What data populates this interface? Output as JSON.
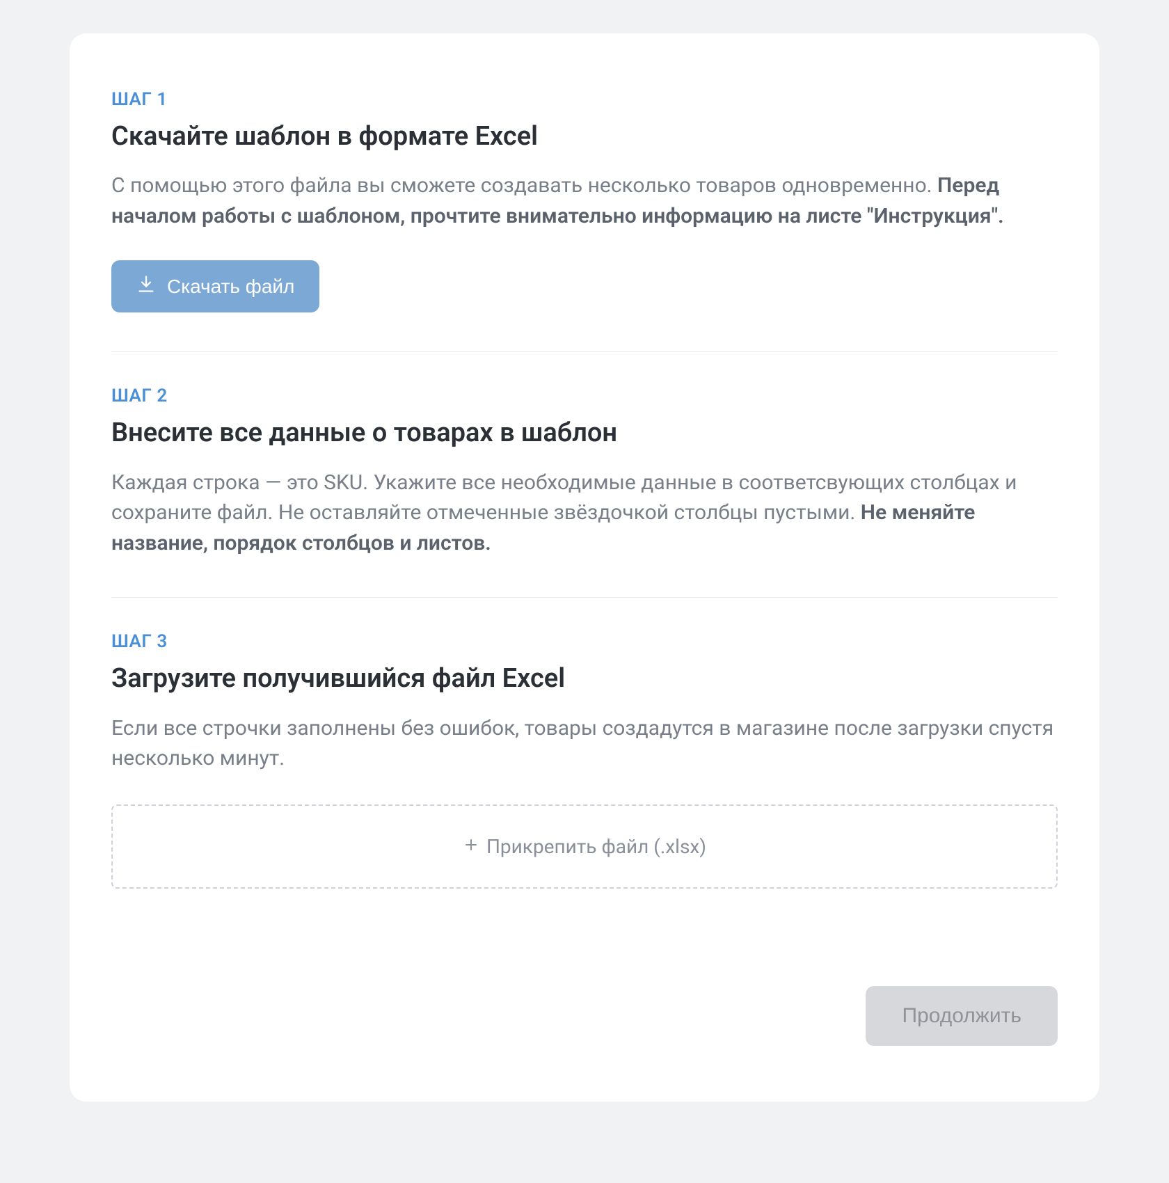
{
  "steps": [
    {
      "label": "ШАГ 1",
      "title": "Скачайте шаблон в формате Excel",
      "desc_plain": "С помощью этого файла вы сможете создавать несколько товаров одновременно. ",
      "desc_bold": "Перед началом работы с шаблоном, прочтите внимательно информацию на листе \"Инструкция\".",
      "button_label": "Скачать файл"
    },
    {
      "label": "ШАГ 2",
      "title": "Внесите все данные о товарах в шаблон",
      "desc_plain": "Каждая строка — это SKU. Укажите все необходимые данные в соответсвующих столбцах и сохраните файл. Не оставляйте отмеченные звёздочкой столбцы пустыми. ",
      "desc_bold": "Не меняйте название, порядок столбцов и листов."
    },
    {
      "label": "ШАГ 3",
      "title": "Загрузите получившийся файл Excel",
      "desc_plain": "Если все строчки заполнены без ошибок, товары создадутся в магазине после загрузки спустя несколько минут.",
      "dropzone_label": "Прикрепить файл (.xlsx)"
    }
  ],
  "continue_label": "Продолжить",
  "colors": {
    "accent": "#4b8fd6",
    "button_bg": "#7ba8d4",
    "disabled_bg": "#d7d8dc",
    "text_muted": "#797f89"
  }
}
